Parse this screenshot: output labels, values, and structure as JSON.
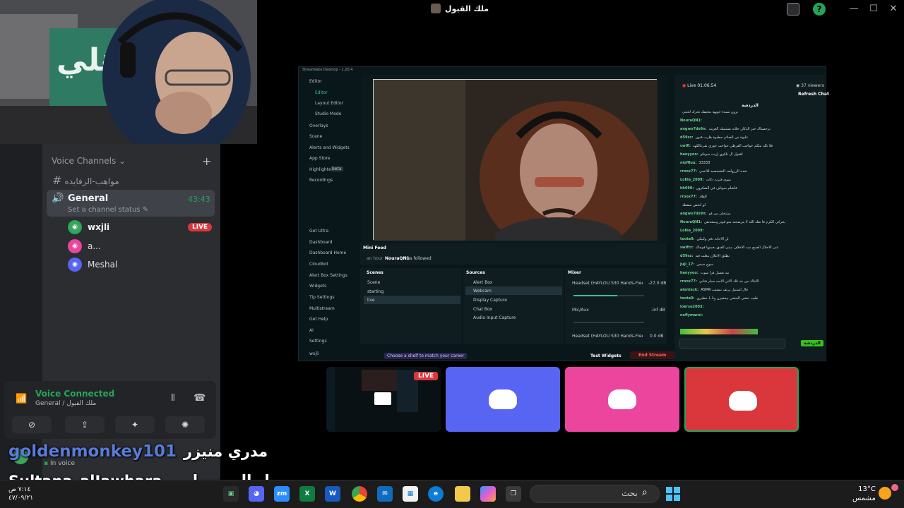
{
  "window": {
    "title": "ملك القبول"
  },
  "sidebar": {
    "voice_channels_label": "Voice Channels",
    "text_channel": "مواهب-الرفايده",
    "general": {
      "name": "General",
      "timer": "43:43",
      "status_placeholder": "Set a channel status"
    },
    "members": [
      {
        "name": "wxjli",
        "live": "LIVE",
        "color": "#3ba55c"
      },
      {
        "name": "a...",
        "live": "",
        "color": "#eb459e"
      },
      {
        "name": "Meshal",
        "live": "",
        "color": "#5865f2"
      }
    ],
    "voice_connected": {
      "title": "Voice Connected",
      "subtitle": "General / ملك القبول"
    },
    "user_status": "In voice"
  },
  "stream": {
    "app_title": "Streamlabs Desktop - 1.20.4",
    "viewers": "37 viewers",
    "live_time": "Live 01:06:54",
    "refresh_chat": "Refresh Chat",
    "chat_header": "الدردشة",
    "nav": [
      "Editor",
      "Editor",
      "Layout Editor",
      "Studio Mode",
      "Overlays",
      "Scene",
      "Alerts and Widgets",
      "App Store",
      "Highlighter",
      "Recordings",
      "Get Ultra",
      "Dashboard",
      "Dashboard Home",
      "Cloudbot",
      "Alert Box Settings",
      "Widgets",
      "Tip Settings",
      "Multistream",
      "Get Help",
      "AI",
      "Settings",
      "wxjli"
    ],
    "highlighter_badge": "beta",
    "mini_feed": {
      "title": "Mini Feed",
      "event_time": "an hour",
      "event_user": "NouraQN1",
      "event_text": "has followed"
    },
    "scenes": {
      "title": "Scenes",
      "items": [
        "Scene",
        "starting",
        "live"
      ]
    },
    "sources": {
      "title": "Sources",
      "items": [
        "Alert Box",
        "Webcam",
        "Display Capture",
        "Chat Box",
        "Audio Input Capture"
      ]
    },
    "mixer": {
      "title": "Mixer",
      "tracks": [
        {
          "name": "Headset (HAYLOU S30 Hands-Free AG A...",
          "db": "-27.0 dB",
          "level": 0.62
        },
        {
          "name": "Mic/Aux",
          "db": "-inf dB",
          "level": 0.0
        },
        {
          "name": "Headset (HAYLOU S30 Hands-Free AG A...",
          "db": "0.0 dB",
          "level": 0.0
        }
      ]
    },
    "bottom": {
      "shelf_hint": "Choose a shelf to match your career",
      "test_widgets": "Test Widgets",
      "end_stream": "End Stream"
    },
    "chat_send": "الدردشة",
    "chat_lines": [
      {
        "user": "",
        "text": "بزون سيدة جويهة بتحيفك تحرك لحنتي"
      },
      {
        "user": "NouraQN1:",
        "text": ""
      },
      {
        "user": "angwo7ds9n:",
        "text": "ترحسناك خبز الدكان حلاته تستنيتك الغزينه"
      },
      {
        "user": "d59sz:",
        "text": "عليوة من الصائم حطيوة هلرت فنون"
      },
      {
        "user": "cwifi:",
        "text": "فلا تلك ملكم حواجب القرطي جواجب جوري تقرعالكهد"
      },
      {
        "user": "haoyyoo:",
        "text": "افقول ال تلكوي إزبت سوتكو"
      },
      {
        "user": "nioffiuu:",
        "text": "33333"
      },
      {
        "user": "rroox77:",
        "text": "شده الزروانف التشخصية للاعمي"
      },
      {
        "user": "Lollia_2009:",
        "text": "سوى فثرنه ذكات"
      },
      {
        "user": "kh690:",
        "text": "فاشلم سوتاف في الشكرون"
      },
      {
        "user": "rroox77:",
        "text": "القلاد"
      },
      {
        "user": "",
        "text": "لو اتحض سقطة"
      },
      {
        "user": "angwo7ds9n:",
        "text": "ستتحلى من فو"
      },
      {
        "user": "NouraQN1:",
        "text": "بحراتي الكرم فا نقله الله لا يترشحنه منو فوتر وسعدتقن"
      },
      {
        "user": "Lollia_2009:",
        "text": ""
      },
      {
        "user": "toota0:",
        "text": "بل الاجابة دقي ولبيكن"
      },
      {
        "user": "swiftz:",
        "text": "عنى الاحلال الصبح مت الاخلاف مبتى الفنق بحميها فوجاك"
      },
      {
        "user": "d59sz:",
        "text": "نطلق الاعلان بنعلت فيه"
      },
      {
        "user": "Juji_17:",
        "text": "سوح سبس"
      },
      {
        "user": "haoyyoo:",
        "text": "تيه تقسل فرا سوت"
      },
      {
        "user": "rroox77:",
        "text": "الانتاك من بند تلك الاتي الاسه سبار فتاني"
      },
      {
        "user": "alonteck:",
        "text": "ASMR قال اشتنيل يرنف بتشتب"
      },
      {
        "user": "toota0:",
        "text": "طيب عشي الحشي بيحقيزن ونا يا خطيري"
      },
      {
        "user": "loersu2003:",
        "text": ""
      },
      {
        "user": "noflymaroi:",
        "text": ""
      }
    ]
  },
  "tiles": {
    "live_label": "LIVE",
    "colors": [
      "#5865f2",
      "#eb459e",
      "#da373c"
    ]
  },
  "overlay": {
    "line1_user": "goldenmonkey101",
    "line1_msg": "مدري منيزر",
    "line2_user": "Sultana_alJawhara",
    "line2_msg": "وصل المرسول"
  },
  "taskbar": {
    "search_placeholder": "بحث",
    "weather_temp": "13°C",
    "weather_desc": "مشمس",
    "clock_time": "٧:١٤ ص",
    "clock_date": "٤٧/٠٩/٢١",
    "apps": [
      "zm",
      "X",
      "W"
    ]
  }
}
